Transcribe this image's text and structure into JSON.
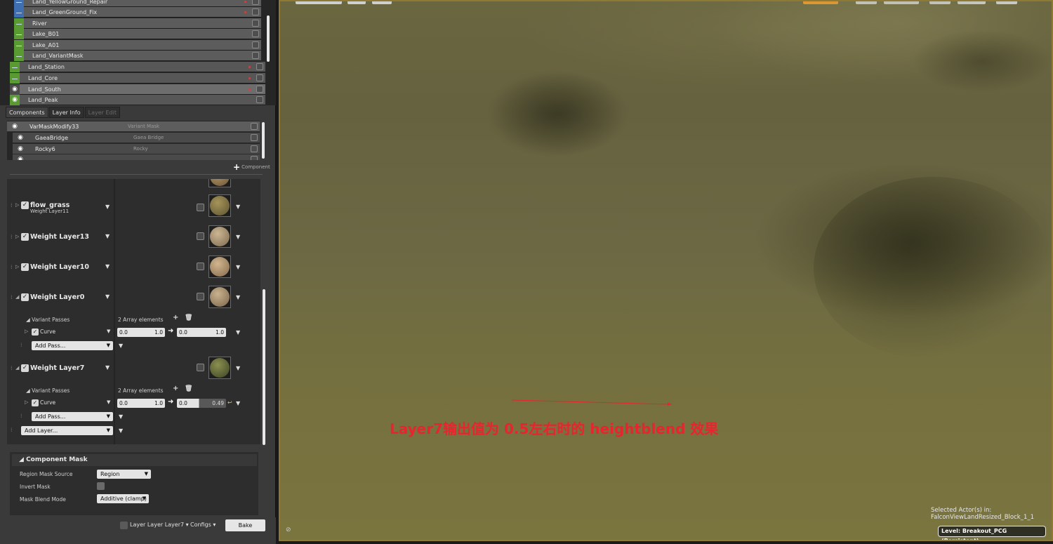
{
  "layers": [
    {
      "name": "Land_YellowGround_Repair",
      "kind": "sub",
      "color": "blue",
      "dot": true
    },
    {
      "name": "Land_GreenGround_Fix",
      "kind": "sub",
      "color": "blue",
      "dot": true
    },
    {
      "name": "River",
      "kind": "sub",
      "color": "green",
      "dot": false
    },
    {
      "name": "Lake_B01",
      "kind": "sub",
      "color": "green",
      "dot": false
    },
    {
      "name": "Lake_A01",
      "kind": "sub",
      "color": "green",
      "dot": false
    },
    {
      "name": "Land_VariantMask",
      "kind": "sub",
      "color": "green",
      "dot": false
    },
    {
      "name": "Land_Station",
      "kind": "main",
      "color": "green",
      "dot": true
    },
    {
      "name": "Land_Core",
      "kind": "main",
      "color": "green",
      "dot": true
    },
    {
      "name": "Land_South",
      "kind": "sel",
      "color": "grey",
      "dot": true,
      "eye": true
    },
    {
      "name": "Land_Peak",
      "kind": "main",
      "color": "green",
      "dot": false,
      "eye": true
    }
  ],
  "tabs": {
    "components": "Components",
    "layer_info": "Layer Info",
    "layer_edit": "Layer Edit"
  },
  "components": [
    {
      "name": "VarMaskModify33",
      "type": "Variant Mask"
    },
    {
      "name": "GaeaBridge",
      "type": "Gaea Bridge"
    },
    {
      "name": "Rocky6",
      "type": "Rocky"
    }
  ],
  "add_component": "Component",
  "weight_layers": {
    "flow_grass": {
      "name": "flow_grass",
      "sub": "Weight Layer11"
    },
    "wl13": {
      "name": "Weight Layer13"
    },
    "wl10": {
      "name": "Weight Layer10"
    },
    "wl0": {
      "name": "Weight Layer0"
    },
    "wl7": {
      "name": "Weight Layer7"
    }
  },
  "variant_passes": {
    "label": "Variant Passes",
    "count_label": "2 Array elements",
    "curve_label": "Curve",
    "add_pass": "Add Pass...",
    "wl0": {
      "in_min": "0.0",
      "in_max": "1.0",
      "out_min": "0.0",
      "out_max": "1.0"
    },
    "wl7": {
      "in_min": "0.0",
      "in_max": "1.0",
      "out_min": "0.0",
      "out_max": "0.49",
      "out_fill": 0.49
    }
  },
  "add_layer": "Add Layer...",
  "component_mask": {
    "title": "Component Mask",
    "region_source_label": "Region Mask Source",
    "region_source_value": "Region",
    "invert_label": "Invert Mask",
    "blend_label": "Mask Blend Mode",
    "blend_value": "Additive (clamp)"
  },
  "bottom": {
    "layer_toggle": "Layer Layer Layer7",
    "configs": "Configs",
    "bake": "Bake"
  },
  "viewport": {
    "note": "Layer7输出值为 0.5左右时的 heightblend 效果",
    "selected_line1": "Selected Actor(s) in:",
    "selected_line2": "FalconViewLandResized_Block_1_1",
    "level": "Level:  Breakout_PCG (Persistent)"
  },
  "colors": {
    "annotation": "#e8242e",
    "viewport_border": "#8f7a35",
    "layer_blue": "#3f6fb0",
    "layer_green": "#5a9a33"
  }
}
